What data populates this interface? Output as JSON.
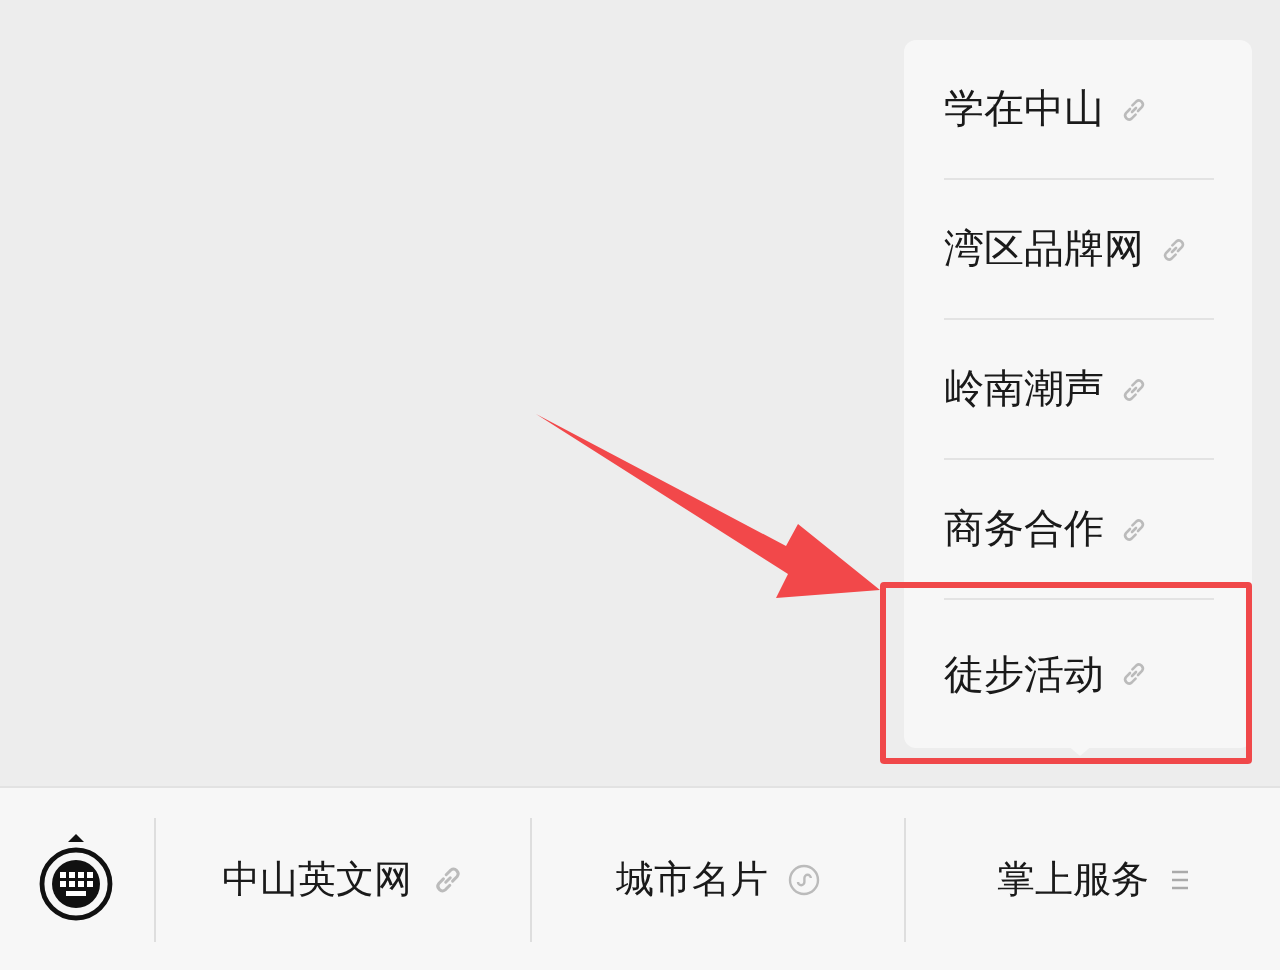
{
  "submenu": [
    {
      "label": "学在中山",
      "highlighted": false
    },
    {
      "label": "湾区品牌网",
      "highlighted": false
    },
    {
      "label": "岭南潮声",
      "highlighted": false
    },
    {
      "label": "商务合作",
      "highlighted": false
    },
    {
      "label": "徒步活动",
      "highlighted": true
    }
  ],
  "menu_bar": [
    {
      "label": "中山英文网",
      "kind": "link"
    },
    {
      "label": "城市名片",
      "kind": "miniprogram"
    },
    {
      "label": "掌上服务",
      "kind": "submenu"
    }
  ]
}
